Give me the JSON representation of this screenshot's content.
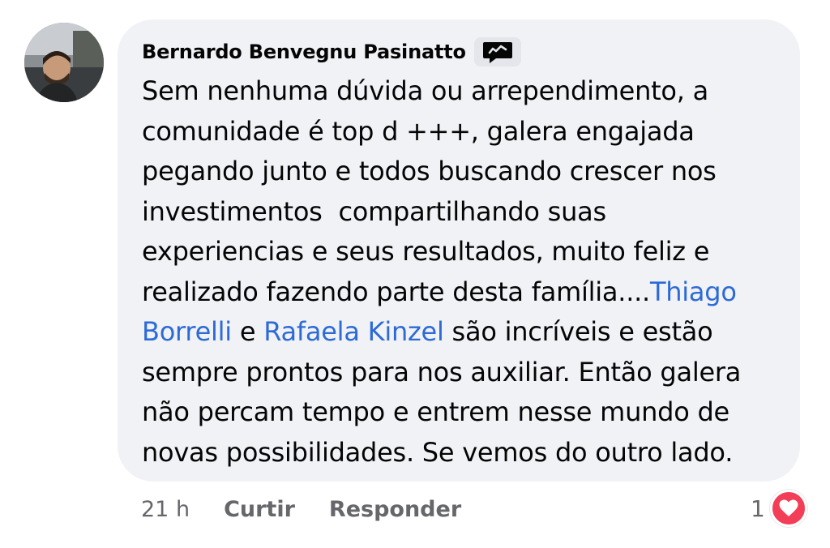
{
  "comment": {
    "author": "Bernardo Benvegnu Pasinatto",
    "badge_icon": "top-fan-chat-icon",
    "avatar_icon": "profile-photo",
    "lines": [
      [
        {
          "text": "Sem nenhuma dúvida ou arrependimento, a",
          "mention": false
        }
      ],
      [
        {
          "text": "comunidade é top d +++, galera engajada",
          "mention": false
        }
      ],
      [
        {
          "text": "pegando junto e todos buscando crescer nos",
          "mention": false
        }
      ],
      [
        {
          "text": "investimentos  compartilhando suas",
          "mention": false
        }
      ],
      [
        {
          "text": "experiencias e seus resultados, muito feliz e",
          "mention": false
        }
      ],
      [
        {
          "text": "realizado fazendo parte desta família....",
          "mention": false
        },
        {
          "text": "Thiago",
          "mention": true
        }
      ],
      [
        {
          "text": "Borrelli",
          "mention": true
        },
        {
          "text": " e ",
          "mention": false
        },
        {
          "text": "Rafaela Kinzel",
          "mention": true
        },
        {
          "text": " são incríveis e estão",
          "mention": false
        }
      ],
      [
        {
          "text": "sempre prontos para nos auxiliar. Então galera",
          "mention": false
        }
      ],
      [
        {
          "text": "não percam tempo e entrem nesse mundo de",
          "mention": false
        }
      ],
      [
        {
          "text": "novas possibilidades. Se vemos do outro lado.",
          "mention": false
        }
      ]
    ],
    "mention_color": "#2d6ad6",
    "bubble_color": "#f0f2f5"
  },
  "actions": {
    "time": "21 h",
    "like_label": "Curtir",
    "reply_label": "Responder"
  },
  "reactions": {
    "count": "1",
    "icon": "heart-icon",
    "color": "#f33e58"
  }
}
